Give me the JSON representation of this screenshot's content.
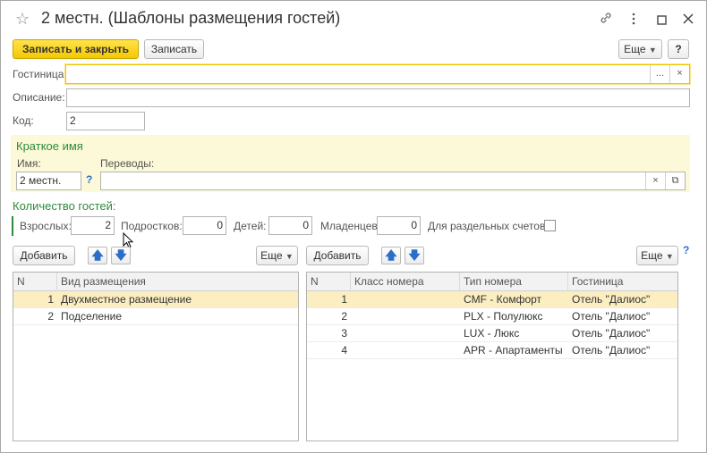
{
  "window": {
    "title": "2 местн. (Шаблоны размещения гостей)"
  },
  "toolbar": {
    "save_close": "Записать и закрыть",
    "save": "Записать",
    "more": "Еще",
    "help": "?"
  },
  "fields": {
    "hotel_label": "Гостиница:",
    "hotel_value": "",
    "hotel_pick": "...",
    "hotel_clear": "×",
    "description_label": "Описание:",
    "description_value": "",
    "code_label": "Код:",
    "code_value": "2"
  },
  "short_name": {
    "title": "Краткое имя",
    "name_label": "Имя:",
    "name_value": "2 местн.",
    "help": "?",
    "translations_label": "Переводы:",
    "translations_value": "",
    "clear": "×",
    "open": "⧉"
  },
  "guests": {
    "title": "Количество гостей:",
    "adults_label": "Взрослых:",
    "adults_value": "2",
    "teens_label": "Подростков:",
    "teens_value": "0",
    "children_label": "Детей:",
    "children_value": "0",
    "infants_label": "Младенцев:",
    "infants_value": "0",
    "separate_label": "Для раздельных счетов:"
  },
  "left_table": {
    "add": "Добавить",
    "more": "Еще",
    "columns": [
      "N",
      "Вид размещения"
    ],
    "rows": [
      {
        "n": "1",
        "kind": "Двухместное размещение"
      },
      {
        "n": "2",
        "kind": "Подселение"
      }
    ]
  },
  "right_table": {
    "add": "Добавить",
    "more": "Еще",
    "help": "?",
    "columns": [
      "N",
      "Класс номера",
      "Тип номера",
      "Гостиница"
    ],
    "rows": [
      {
        "n": "1",
        "class": "",
        "type": "CMF - Комфорт",
        "hotel": "Отель \"Далиос\""
      },
      {
        "n": "2",
        "class": "",
        "type": "PLX - Полулюкс",
        "hotel": "Отель \"Далиос\""
      },
      {
        "n": "3",
        "class": "",
        "type": "LUX - Люкс",
        "hotel": "Отель \"Далиос\""
      },
      {
        "n": "4",
        "class": "",
        "type": "APR - Апартаменты",
        "hotel": "Отель \"Далиос\""
      }
    ]
  },
  "colors": {
    "accent_yellow": "#f5c800",
    "section_green": "#2e8b3c",
    "selected_row": "#fbeec1",
    "group_bg": "#fbf9d7"
  }
}
